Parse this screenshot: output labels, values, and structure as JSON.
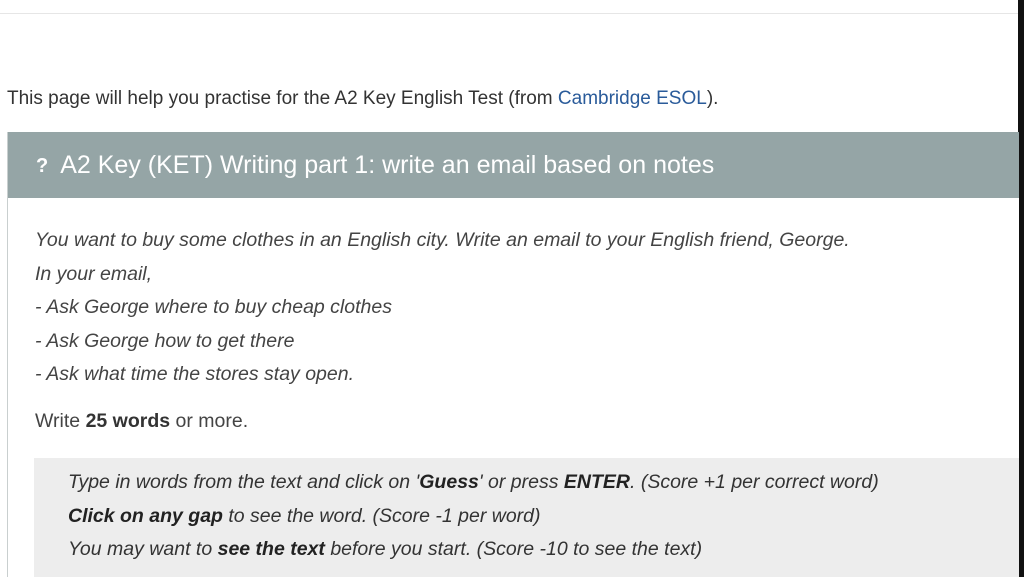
{
  "intro": {
    "text_before": "This page will help you practise for the A2 Key English Test (from ",
    "link_label": "Cambridge ESOL",
    "text_after": ")."
  },
  "panel": {
    "icon": "question-mark-icon",
    "icon_glyph": "?",
    "title": "A2 Key (KET) Writing part 1: write an email based on notes"
  },
  "task": {
    "lines": [
      "You want to buy some clothes in an English city. Write an email to your English friend, George.",
      "In your email,",
      "- Ask George where to buy cheap clothes",
      "- Ask George how to get there",
      "- Ask what time the stores stay open."
    ]
  },
  "write": {
    "before": "Write ",
    "bold": "25 words",
    "after": " or more."
  },
  "instructions": {
    "line1": {
      "part1": "Type in words from the text and click on '",
      "bold1": "Guess",
      "part2": "' or press ",
      "bold2": "ENTER",
      "part3": ". (Score +1 per correct word)"
    },
    "line2": {
      "bold": "Click on any gap",
      "rest": " to see the word. (Score -1 per word)"
    },
    "line3": {
      "part1": "You may want to ",
      "bold": "see the text",
      "part2": " before you start. (Score -10 to see the text)"
    }
  },
  "colors": {
    "header_bg": "#95a5a6",
    "link": "#2a5b9a",
    "instructions_bg": "#ededed"
  }
}
